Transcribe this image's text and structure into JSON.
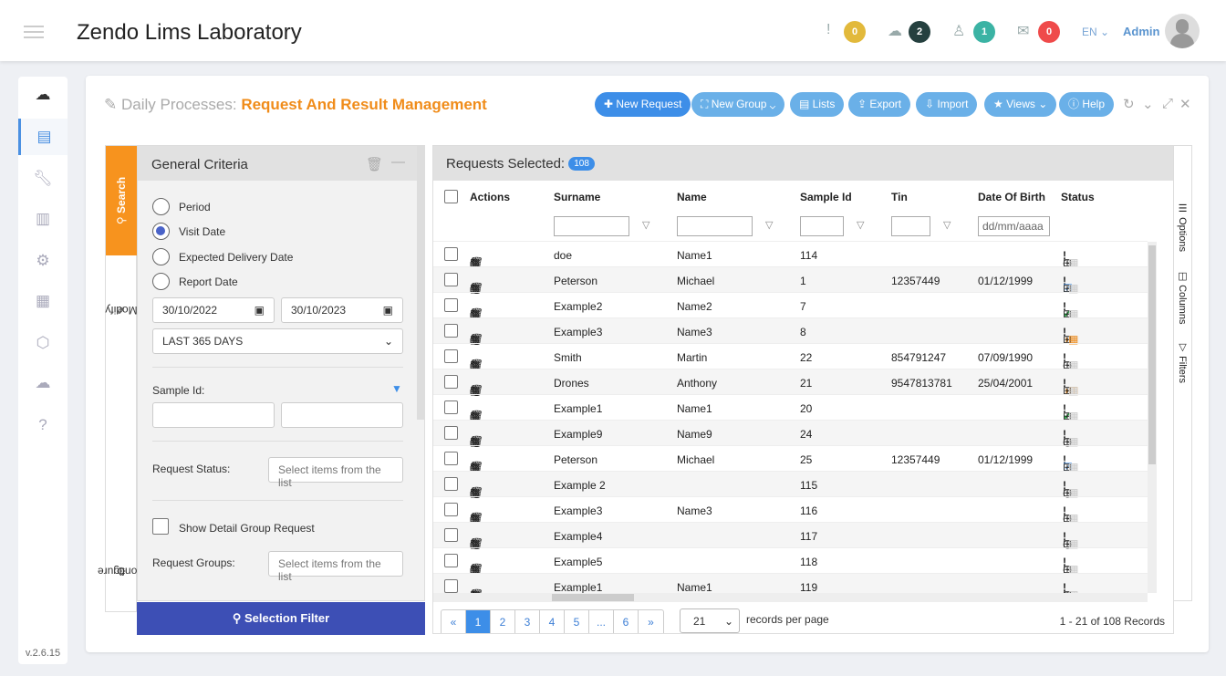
{
  "app": {
    "title": "Zendo Lims Laboratory",
    "version": "v.2.6.15"
  },
  "topbar": {
    "alerts": {
      "icon": "exclamation-icon",
      "count": "0",
      "color": "#e2b93b"
    },
    "uploads": {
      "icon": "cloud-upload-icon",
      "count": "2",
      "color": "#25403f"
    },
    "users": {
      "icon": "users-icon",
      "count": "1",
      "color": "#3bb3a4"
    },
    "messages": {
      "icon": "envelope-open-icon",
      "count": "0",
      "color": "#ef4a4a"
    },
    "language": "EN",
    "user": "Admin"
  },
  "page": {
    "title_prefix": "Daily Processes:",
    "title_main": "Request And Result Management"
  },
  "toolbar": {
    "new_request": "New Request",
    "new_group": "New Group",
    "lists": "Lists",
    "export": "Export",
    "import": "Import",
    "views": "Views",
    "help": "Help"
  },
  "left_tabs": {
    "search": "Search",
    "modify": "Modify",
    "configure": "Configure"
  },
  "criteria": {
    "title": "General Criteria",
    "options": [
      "Period",
      "Visit Date",
      "Expected Delivery Date",
      "Report Date"
    ],
    "selected": "Visit Date",
    "date_from": "30/10/2022",
    "date_to": "30/10/2023",
    "range": "LAST 365 DAYS",
    "sample_id_label": "Sample Id:",
    "request_status_label": "Request Status:",
    "request_status_placeholder": "Select items from the list",
    "show_detail_label": "Show Detail Group Request",
    "request_groups_label": "Request Groups:",
    "request_groups_placeholder": "Select items from the list",
    "filter_button": "Selection Filter"
  },
  "table": {
    "header": "Requests Selected:",
    "selected_count": "108",
    "columns": [
      "Actions",
      "Surname",
      "Name",
      "Sample Id",
      "Tin",
      "Date Of Birth",
      "Status"
    ],
    "dob_placeholder": "dd/mm/aaaa",
    "rows": [
      {
        "surname": "doe",
        "name": "Name1",
        "sample_id": "114",
        "tin": "",
        "dob": "",
        "status": "pending"
      },
      {
        "surname": "Peterson",
        "name": "Michael",
        "sample_id": "1",
        "tin": "12357449",
        "dob": "01/12/1999",
        "status": "validated"
      },
      {
        "surname": "Example2",
        "name": "Name2",
        "sample_id": "7",
        "tin": "",
        "dob": "",
        "status": "completed"
      },
      {
        "surname": "Example3",
        "name": "Name3",
        "sample_id": "8",
        "tin": "",
        "dob": "",
        "status": "partial"
      },
      {
        "surname": "Smith",
        "name": "Martin",
        "sample_id": "22",
        "tin": "854791247",
        "dob": "07/09/1990",
        "status": "pending"
      },
      {
        "surname": "Drones",
        "name": "Anthony",
        "sample_id": "21",
        "tin": "9547813781",
        "dob": "25/04/2001",
        "status": "partial"
      },
      {
        "surname": "Example1",
        "name": "Name1",
        "sample_id": "20",
        "tin": "",
        "dob": "",
        "status": "completed"
      },
      {
        "surname": "Example9",
        "name": "Name9",
        "sample_id": "24",
        "tin": "",
        "dob": "",
        "status": "pending"
      },
      {
        "surname": "Peterson",
        "name": "Michael",
        "sample_id": "25",
        "tin": "12357449",
        "dob": "01/12/1999",
        "status": "validated"
      },
      {
        "surname": "Example 2",
        "name": "",
        "sample_id": "115",
        "tin": "",
        "dob": "",
        "status": "pending"
      },
      {
        "surname": "Example3",
        "name": "Name3",
        "sample_id": "116",
        "tin": "",
        "dob": "",
        "status": "pending"
      },
      {
        "surname": "Example4",
        "name": "",
        "sample_id": "117",
        "tin": "",
        "dob": "",
        "status": "pending"
      },
      {
        "surname": "Example5",
        "name": "",
        "sample_id": "118",
        "tin": "",
        "dob": "",
        "status": "pending"
      },
      {
        "surname": "Example1",
        "name": "Name1",
        "sample_id": "119",
        "tin": "",
        "dob": "",
        "status": "pending"
      }
    ],
    "side_tabs": [
      "Options",
      "Columns",
      "Filters"
    ],
    "pagination": {
      "pages": [
        "«",
        "1",
        "2",
        "3",
        "4",
        "5",
        "...",
        "6",
        "»"
      ],
      "current": "1",
      "per_page": "21",
      "per_page_label": "records per page",
      "summary": "1 - 21 of 108 Records"
    }
  }
}
